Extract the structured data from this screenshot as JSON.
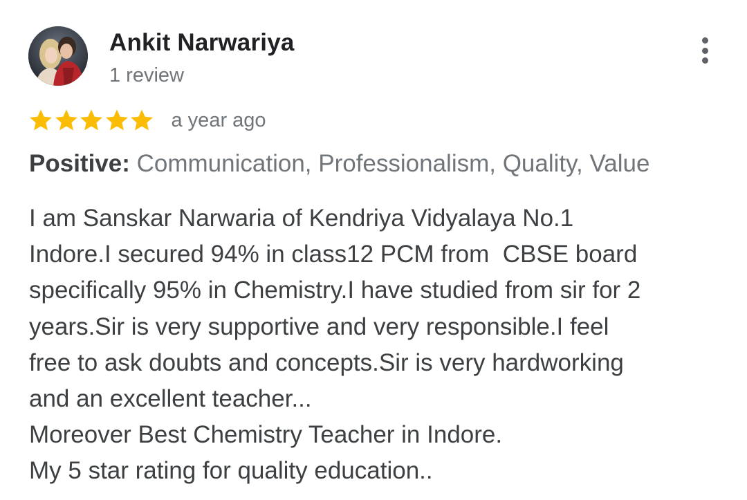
{
  "review": {
    "reviewer_name": "Ankit Narwariya",
    "review_count": "1 review",
    "rating": 5,
    "rating_max": 5,
    "time_ago": "a year ago",
    "attributes_label": "Positive:",
    "attributes_values": "Communication, Professionalism, Quality, Value",
    "text_lines": [
      "I am Sanskar Narwaria of Kendriya Vidyalaya No.1",
      "Indore.I secured 94% in class12 PCM from  CBSE board",
      "specifically 95% in Chemistry.I have studied from sir for 2",
      "years.Sir is very supportive and very responsible.I feel",
      "free to ask doubts and concepts.Sir is very hardworking",
      "and an excellent teacher...",
      "Moreover Best Chemistry Teacher in Indore.",
      "My 5 star rating for quality education.."
    ]
  },
  "colors": {
    "star": "#fbbc04",
    "name": "#202124",
    "secondary_text": "#70757a",
    "body_text": "#3c4043",
    "menu_dots": "#5f6368"
  },
  "icons": {
    "avatar": "profile-photo-icon",
    "menu": "more-vert-icon",
    "star": "star-filled-icon"
  }
}
